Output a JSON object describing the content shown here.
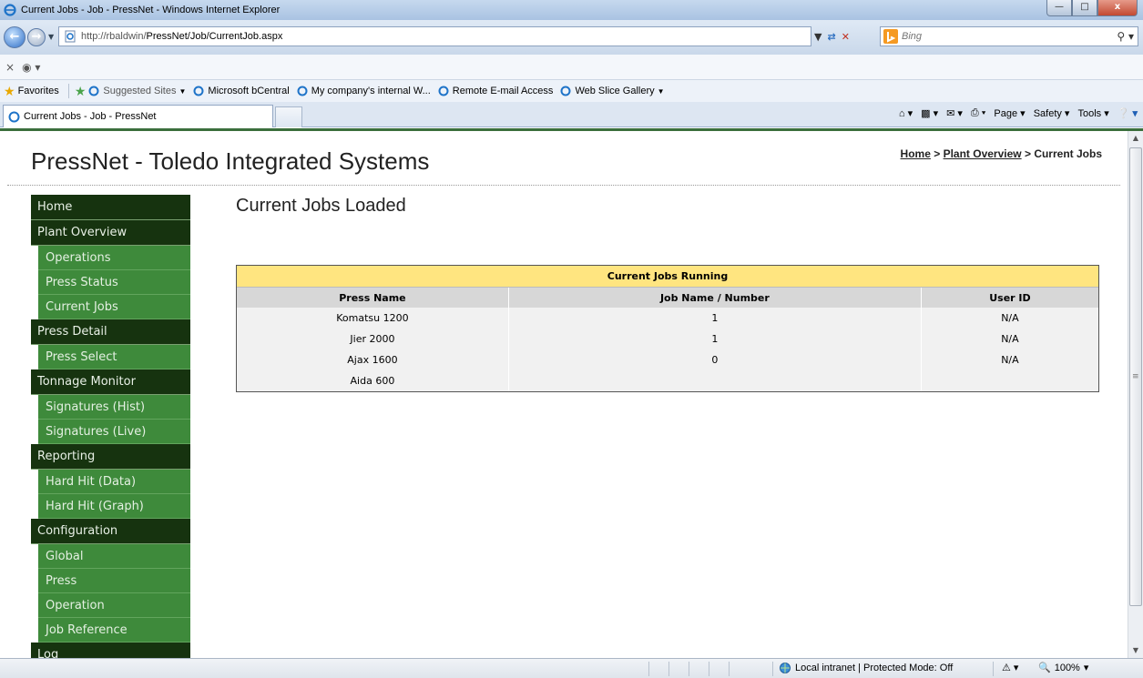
{
  "window": {
    "title": "Current Jobs - Job - PressNet - Windows Internet Explorer"
  },
  "browser": {
    "url_prefix": "http://rbaldwin/",
    "url_path": "PressNet/Job/CurrentJob.aspx",
    "search_placeholder": "Bing",
    "favorites_label": "Favorites",
    "favorites": [
      {
        "label": "Suggested Sites"
      },
      {
        "label": "Microsoft bCentral"
      },
      {
        "label": "My company's internal W..."
      },
      {
        "label": "Remote E-mail Access"
      },
      {
        "label": "Web Slice Gallery"
      }
    ],
    "tab_title": "Current Jobs - Job - PressNet",
    "commands": {
      "page": "Page",
      "safety": "Safety",
      "tools": "Tools"
    },
    "status": {
      "zone": "Local intranet | Protected Mode: Off",
      "zoom": "100%"
    }
  },
  "site": {
    "title": "PressNet - Toledo Integrated Systems",
    "breadcrumb": {
      "home": "Home",
      "sep1": " > ",
      "plant": "Plant Overview",
      "sep2": " > ",
      "current": "Current Jobs"
    }
  },
  "nav": {
    "home": "Home",
    "plant_overview": "Plant Overview",
    "operations": "Operations",
    "press_status": "Press Status",
    "current_jobs": "Current Jobs",
    "press_detail": "Press Detail",
    "press_select": "Press Select",
    "tonnage_monitor": "Tonnage Monitor",
    "signatures_hist": "Signatures (Hist)",
    "signatures_live": "Signatures (Live)",
    "reporting": "Reporting",
    "hard_hit_data": "Hard Hit (Data)",
    "hard_hit_graph": "Hard Hit (Graph)",
    "configuration": "Configuration",
    "global": "Global",
    "press": "Press",
    "operation": "Operation",
    "job_reference": "Job Reference",
    "log": "Log"
  },
  "main": {
    "heading": "Current Jobs Loaded",
    "table": {
      "caption": "Current Jobs Running",
      "headers": [
        "Press Name",
        "Job Name / Number",
        "User ID"
      ],
      "rows": [
        [
          "Komatsu 1200",
          "1",
          "N/A"
        ],
        [
          "Jier 2000",
          "1",
          "N/A"
        ],
        [
          "Ajax 1600",
          "0",
          "N/A"
        ],
        [
          "Aida 600",
          "",
          ""
        ]
      ]
    }
  }
}
